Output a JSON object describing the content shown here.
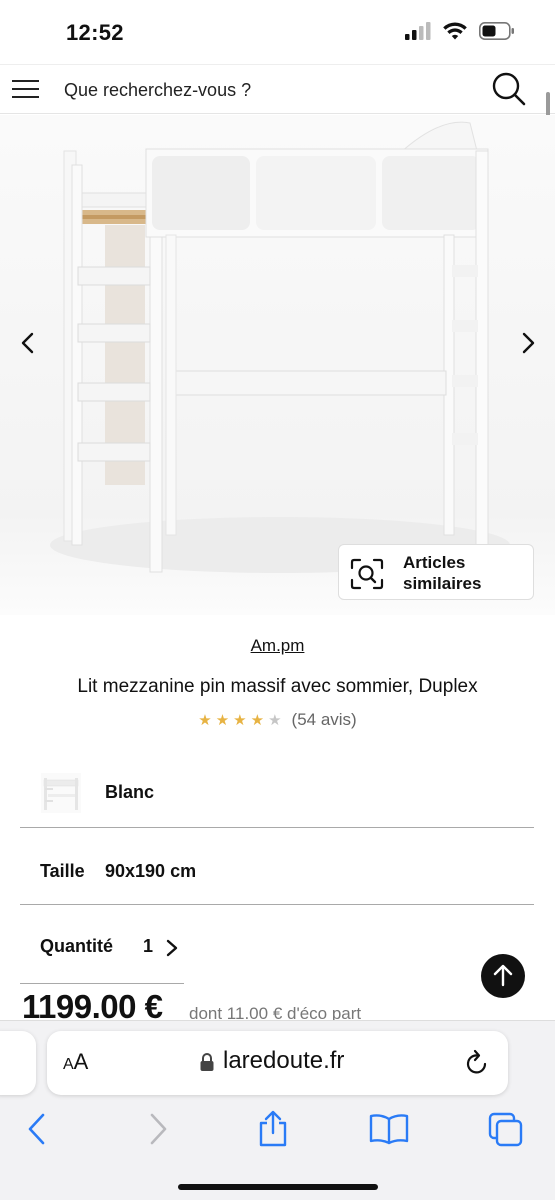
{
  "status_bar": {
    "time": "12:52"
  },
  "header": {
    "search_placeholder": "Que recherchez-vous ?"
  },
  "gallery": {
    "similar_articles_label": "Articles similaires"
  },
  "product": {
    "brand": "Am.pm",
    "title": "Lit mezzanine pin massif avec sommier, Duplex",
    "rating": 4,
    "rating_max": 5,
    "review_count": "(54 avis)",
    "color": "Blanc",
    "size_label": "Taille",
    "size_value": "90x190 cm",
    "quantity_label": "Quantité",
    "quantity_value": "1",
    "price": "1199.00 €",
    "eco_part": "dont 11.00 € d'éco part"
  },
  "browser": {
    "text_size_label_large": "A",
    "text_size_label_small": "A",
    "url": "laredoute.fr",
    "accent_color": "#1a73e8"
  },
  "colors": {
    "star_filled": "#e7b343",
    "star_empty": "#c6c6c6",
    "ios_blue": "#2a7bf6"
  }
}
